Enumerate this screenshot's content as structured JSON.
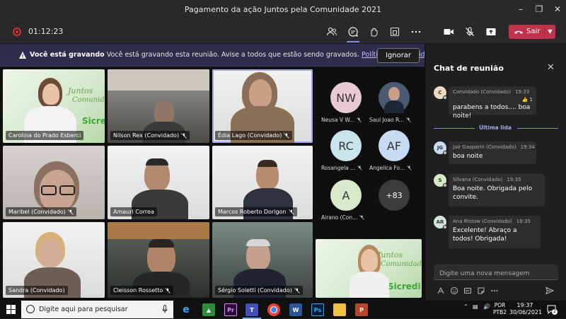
{
  "window": {
    "title": "Pagamento da ação Juntos pela Comunidade 2021"
  },
  "toolbar": {
    "timer": "01:12:23",
    "leave_label": "Sair"
  },
  "banner": {
    "bold": "Você está gravando",
    "text": "Você está gravando esta reunião. Avise a todos que estão sendo gravados.",
    "link": "Política de privacidade",
    "ignore_label": "Ignorar"
  },
  "tiles": [
    {
      "name": "Carolina do Prado Esberci"
    },
    {
      "name": "Nilson Rex (Convidado)"
    },
    {
      "name": "Édia Lago (Convidado)"
    },
    {
      "name": "Maribel (Convidado)"
    },
    {
      "name": "Amauri Correa"
    },
    {
      "name": "Marcos Roberto Dorigon"
    },
    {
      "name": "Sandra (Convidado)"
    },
    {
      "name": "Cleisson Rossetto"
    },
    {
      "name": "Sérgio Soletti (Convidado)"
    }
  ],
  "branding": {
    "juntos": "Juntos",
    "comunidade": "Comunidade",
    "sicredi": "Sicredi",
    "sicredi_partial": "Sicred"
  },
  "avatars": [
    {
      "initials": "NW",
      "label": "Neusa V W...",
      "color": "#e8c9d6",
      "text_color": "#333"
    },
    {
      "initials": "",
      "label": "Saul Joao R...",
      "color": "#4a5a70",
      "text_color": "#fff"
    },
    {
      "initials": "RC",
      "label": "Rosangela ...",
      "color": "#c9e4ea",
      "text_color": "#333"
    },
    {
      "initials": "AF",
      "label": "Angelica Fo...",
      "color": "#c7dcf2",
      "text_color": "#333"
    },
    {
      "initials": "A",
      "label": "Airano (Con...",
      "color": "#d9e8c8",
      "text_color": "#333"
    },
    {
      "initials": "+83",
      "label": "",
      "color": "#3b3b3b",
      "text_color": "#fff"
    }
  ],
  "chat": {
    "title": "Chat de reunião",
    "last_read": "Última lida",
    "compose_placeholder": "Digite uma nova mensagem",
    "messages": [
      {
        "initials": "C",
        "author": "Convidado (Convidado)",
        "time": "19:33",
        "text": "parabens a todos.... boa noite!",
        "reaction": "1",
        "avatar_color": "#f0d9c0"
      },
      {
        "initials": "JG",
        "author": "Jair Gasparin (Convidado)",
        "time": "19:34",
        "text": "boa noite",
        "avatar_color": "#c7dcf2"
      },
      {
        "initials": "S",
        "author": "Silvana (Convidado)",
        "time": "19:35",
        "text": "Boa noite. Obrigada pelo convite.",
        "avatar_color": "#d9e8c8"
      },
      {
        "initials": "AR",
        "author": "Ana Ristow (Convidado)",
        "time": "19:35",
        "text": "Excelente! Abraço a todos! Obrigada!",
        "avatar_color": "#cfe8d8"
      }
    ]
  },
  "taskbar": {
    "search_placeholder": "Digite aqui para pesquisar",
    "lang_top": "POR",
    "lang_bottom": "PTB2",
    "time": "19:37",
    "date": "30/06/2021",
    "notif_count": "2"
  }
}
